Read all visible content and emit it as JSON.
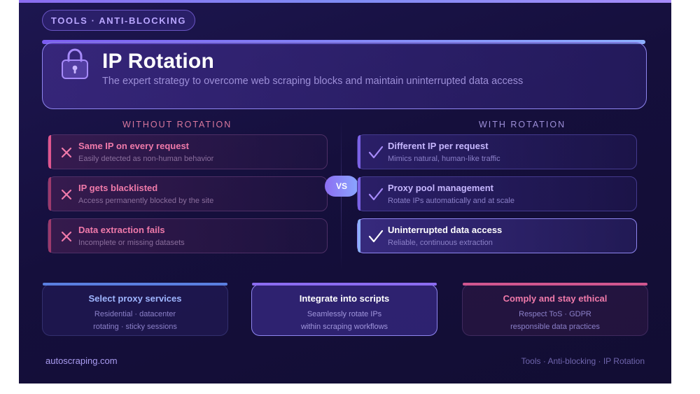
{
  "tag": "TOOLS · ANTI-BLOCKING",
  "hero": {
    "title": "IP Rotation",
    "subtitle": "The expert strategy to overcome web scraping blocks and maintain uninterrupted data access",
    "icon": "lock-icon"
  },
  "without": {
    "heading": "WITHOUT ROTATION",
    "items": [
      {
        "title": "Same IP on every request",
        "desc": "Easily detected as non-human behavior"
      },
      {
        "title": "IP gets blacklisted",
        "desc": "Access permanently blocked by the site"
      },
      {
        "title": "Data extraction fails",
        "desc": "Incomplete or missing datasets"
      }
    ]
  },
  "with": {
    "heading": "WITH ROTATION",
    "items": [
      {
        "title": "Different IP per request",
        "desc": "Mimics natural, human-like traffic"
      },
      {
        "title": "Proxy pool management",
        "desc": "Rotate IPs automatically and at scale"
      },
      {
        "title": "Uninterrupted data access",
        "desc": "Reliable, continuous extraction"
      }
    ]
  },
  "vs_label": "VS",
  "steps": [
    {
      "title": "Select proxy services",
      "line1": "Residential · datacenter",
      "line2": "rotating · sticky sessions"
    },
    {
      "title": "Integrate into scripts",
      "line1": "Seamlessly rotate IPs",
      "line2": "within scraping workflows"
    },
    {
      "title": "Comply and stay ethical",
      "line1": "Respect ToS · GDPR",
      "line2": "responsible data practices"
    }
  ],
  "footer": {
    "site": "autoscraping.com",
    "breadcrumb": "Tools · Anti-blocking · IP Rotation"
  },
  "colors": {
    "background": "#150f3c",
    "accent_purple": "#8b6cf0",
    "accent_pink": "#e0568f",
    "accent_blue": "#8db0ff"
  }
}
